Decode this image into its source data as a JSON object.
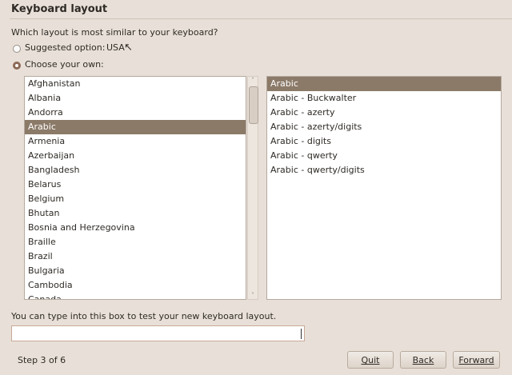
{
  "title": "Keyboard layout",
  "question": "Which layout is most similar to your keyboard?",
  "suggested": {
    "label": "Suggested option:",
    "value": "USA",
    "selected": false
  },
  "choose_own": {
    "label": "Choose your own:",
    "selected": true
  },
  "countries": [
    "Afghanistan",
    "Albania",
    "Andorra",
    "Arabic",
    "Armenia",
    "Azerbaijan",
    "Bangladesh",
    "Belarus",
    "Belgium",
    "Bhutan",
    "Bosnia and Herzegovina",
    "Braille",
    "Brazil",
    "Bulgaria",
    "Cambodia",
    "Canada"
  ],
  "selected_country": "Arabic",
  "variants": [
    "Arabic",
    "Arabic - Buckwalter",
    "Arabic - azerty",
    "Arabic - azerty/digits",
    "Arabic - digits",
    "Arabic - qwerty",
    "Arabic - qwerty/digits"
  ],
  "selected_variant": "Arabic",
  "test_label": "You can type into this box to test your new keyboard layout.",
  "test_value": "",
  "step": "Step 3 of 6",
  "buttons": {
    "quit": "Quit",
    "back": "Back",
    "forward": "Forward"
  }
}
